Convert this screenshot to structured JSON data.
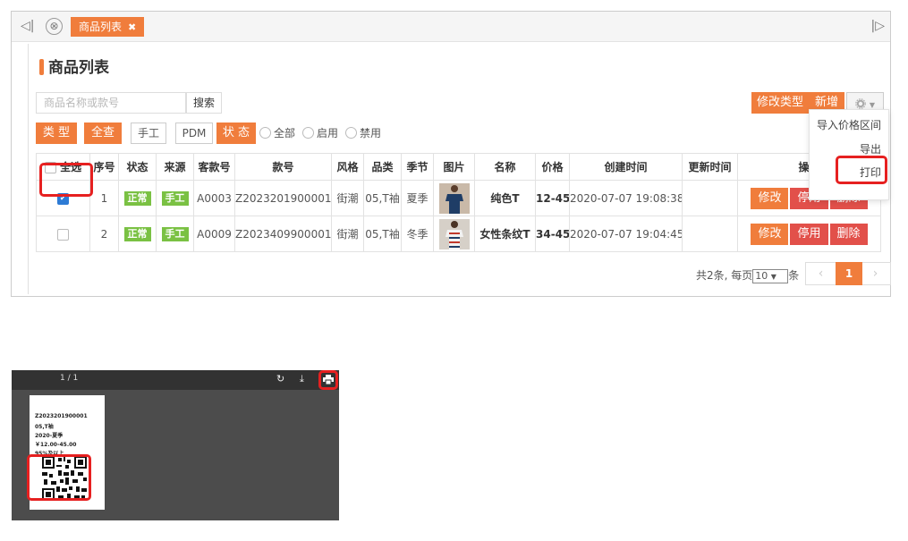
{
  "tabbar": {
    "tab_label": "商品列表",
    "tab_close": "✖",
    "left_icon": "◁|",
    "right_icon": "|▷",
    "close_icon": "⊗"
  },
  "page": {
    "title": "商品列表"
  },
  "search": {
    "placeholder": "商品名称或款号",
    "button": "搜索"
  },
  "filters": {
    "type": "类 型",
    "all_query": "全查",
    "manual": "手工",
    "pdm": "PDM",
    "status": "状 态",
    "radios": [
      "全部",
      "启用",
      "禁用"
    ]
  },
  "toolbar": {
    "modify_type": "修改类型",
    "add": "新增",
    "gear_icon": "gear-icon"
  },
  "dropdown": {
    "items": [
      "导入价格区间",
      "导出",
      "打印"
    ]
  },
  "table": {
    "columns": [
      "全选",
      "序号",
      "状态",
      "来源",
      "客款号",
      "款号",
      "风格",
      "品类",
      "季节",
      "图片",
      "名称",
      "价格",
      "创建时间",
      "更新时间",
      "操作"
    ],
    "rows": [
      {
        "checked": true,
        "index": "1",
        "status": "正常",
        "source": "手工",
        "client_no": "A0003",
        "style_no": "Z2023201900001",
        "style": "街潮",
        "category": "05,T袖",
        "season": "夏季",
        "name": "纯色T",
        "price": "12-45",
        "created": "2020-07-07 19:08:38",
        "updated": "",
        "actions": [
          "修改",
          "停用",
          "删除"
        ]
      },
      {
        "checked": false,
        "index": "2",
        "status": "正常",
        "source": "手工",
        "client_no": "A0009",
        "style_no": "Z2023409900001",
        "style": "街潮",
        "category": "05,T袖",
        "season": "冬季",
        "name": "女性条纹T",
        "price": "34-45",
        "created": "2020-07-07 19:04:45",
        "updated": "",
        "actions": [
          "修改",
          "停用",
          "删除"
        ]
      }
    ]
  },
  "pager": {
    "total_text": "共2条, 每页",
    "page_size": "10",
    "suffix": "条",
    "current": "1",
    "prev": "‹",
    "next": "›"
  },
  "pdf": {
    "pages": "1 / 1",
    "label_lines": [
      "Z2023201900001",
      "05,T袖",
      "2020-夏季",
      "￥12.00-45.00",
      "95%及以上"
    ]
  }
}
